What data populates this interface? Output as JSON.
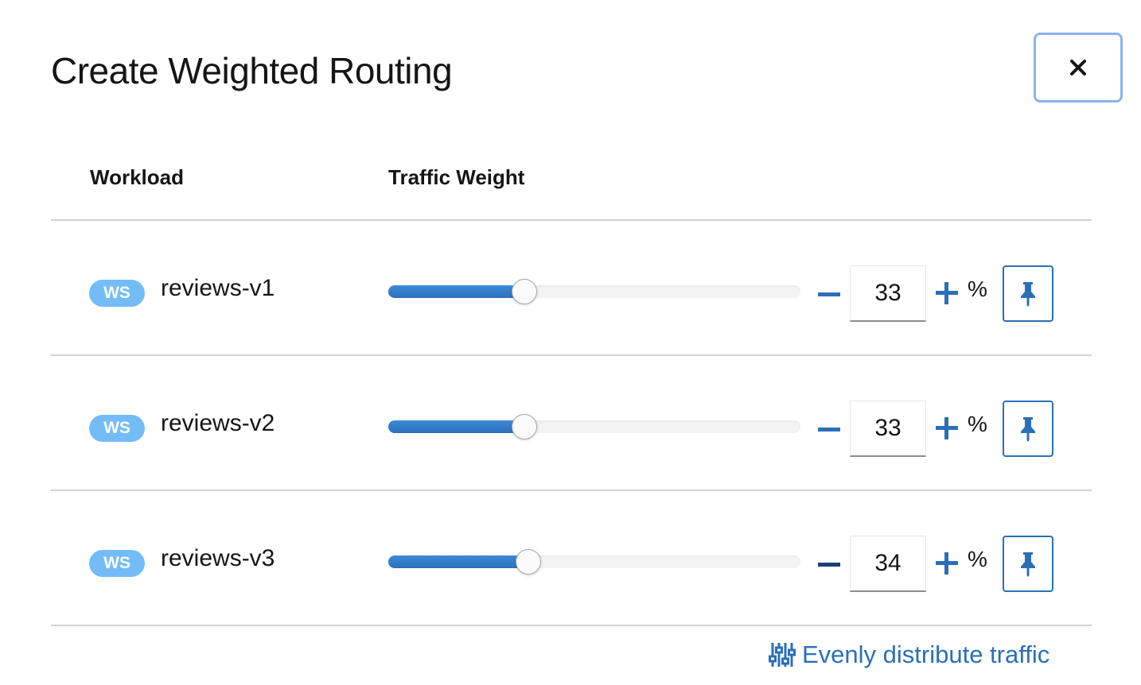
{
  "dialog": {
    "title": "Create Weighted Routing",
    "close_icon": "close-icon"
  },
  "table": {
    "headers": [
      "Workload",
      "Traffic Weight"
    ],
    "rows": [
      {
        "badge": "WS",
        "name": "reviews-v1",
        "weight": 33,
        "weight_text": "33",
        "unit": "%"
      },
      {
        "badge": "WS",
        "name": "reviews-v2",
        "weight": 33,
        "weight_text": "33",
        "unit": "%"
      },
      {
        "badge": "WS",
        "name": "reviews-v3",
        "weight": 34,
        "weight_text": "34",
        "unit": "%"
      }
    ]
  },
  "footer": {
    "evenly_label": "Evenly distribute traffic",
    "evenly_icon": "sliders-icon"
  },
  "colors": {
    "accent": "#2b6fb9",
    "badge": "#73bcf7",
    "close_border": "#8bb3ef"
  }
}
